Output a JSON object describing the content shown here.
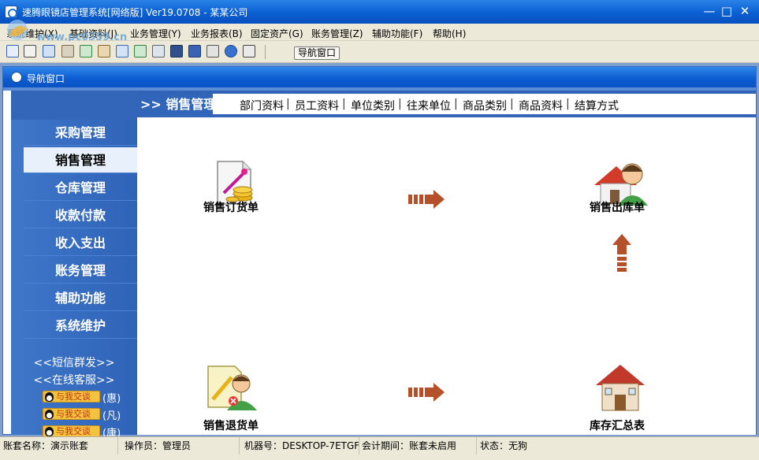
{
  "window": {
    "title": "速腾眼镜店管理系统[网络版] Ver19.0708 - 某某公司",
    "minimize_glyph": "—",
    "maximize_glyph": "□",
    "close_glyph": "✕"
  },
  "watermark": {
    "text": "www.pc0359.cn"
  },
  "menu": {
    "items": [
      {
        "label": "系统维护(X)"
      },
      {
        "label": "基础资料(J)"
      },
      {
        "label": "业务管理(Y)"
      },
      {
        "label": "业务报表(B)"
      },
      {
        "label": "固定资产(G)"
      },
      {
        "label": "账务管理(Z)"
      },
      {
        "label": "辅助功能(F)"
      },
      {
        "label": "帮助(H)"
      }
    ]
  },
  "toolbar": {
    "icons": [
      "grid-icon",
      "list-icon",
      "window-icon",
      "tools-icon",
      "cycle-icon",
      "gear-icon",
      "people-icon",
      "users-icon",
      "printer-icon",
      "monitor-icon",
      "save-icon",
      "print-icon",
      "help-icon",
      "exit-icon"
    ],
    "nav_button_label": "导航窗口"
  },
  "child_window": {
    "title": "导航窗口"
  },
  "sidebar": {
    "items": [
      {
        "label": "采购管理"
      },
      {
        "label": "销售管理"
      },
      {
        "label": "仓库管理"
      },
      {
        "label": "收款付款"
      },
      {
        "label": "收入支出"
      },
      {
        "label": "账务管理"
      },
      {
        "label": "辅助功能"
      },
      {
        "label": "系统维护"
      }
    ],
    "active_index": 1,
    "sms_link": "<<短信群发>>",
    "support_link": "<<在线客服>>",
    "qq_label": "与我交谈",
    "qq_contacts": [
      "(惠)",
      "(凡)",
      "(康)"
    ]
  },
  "tabbar": {
    "heading": ">> 销售管理",
    "links": [
      "部门资料",
      "员工资料",
      "单位类别",
      "往来单位",
      "商品类别",
      "商品资料",
      "结算方式"
    ],
    "separator": "|"
  },
  "flow": {
    "sales_order": "销售订货单",
    "sales_outbound": "销售出库单",
    "sales_return": "销售退货单",
    "inventory_summary": "库存汇总表"
  },
  "statusbar": {
    "account": "账套名称：演示账套",
    "operator": "操作员：管理员",
    "machine": "机器号：DESKTOP-7ETGF",
    "period": "会计期间：账套未启用",
    "state": "状态：无狗"
  },
  "colors": {
    "titlebar": "#0a5fd2",
    "sidebar": "#3366b8",
    "active_item": "#e8f1fb",
    "arrow": "#b4502a"
  }
}
